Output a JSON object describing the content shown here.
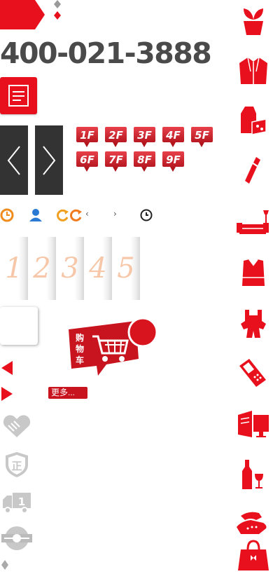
{
  "header": {
    "phone": "400-021-3888"
  },
  "floors": [
    "1F",
    "2F",
    "3F",
    "4F",
    "5F",
    "6F",
    "7F",
    "8F",
    "9F"
  ],
  "numbers": [
    "1",
    "2",
    "3",
    "4",
    "5"
  ],
  "cart": {
    "label": "购物车"
  },
  "more_label": "更多...",
  "colors": {
    "brand_red": "#e8101c",
    "dark": "#333333",
    "gray_icon": "#c8c8c8"
  },
  "icons": {
    "left_column": [
      "handshake-icon",
      "authentic-icon",
      "truck-icon",
      "express-logo-icon"
    ],
    "right_column": [
      "plant-pot-icon",
      "jacket-icon",
      "milk-cheese-icon",
      "lipstick-icon",
      "sofa-lamp-icon",
      "top-shirt-icon",
      "baby-overalls-icon",
      "mobile-phone-icon",
      "computer-icon",
      "wine-icon",
      "telephone-icon",
      "handbag-icon"
    ]
  }
}
